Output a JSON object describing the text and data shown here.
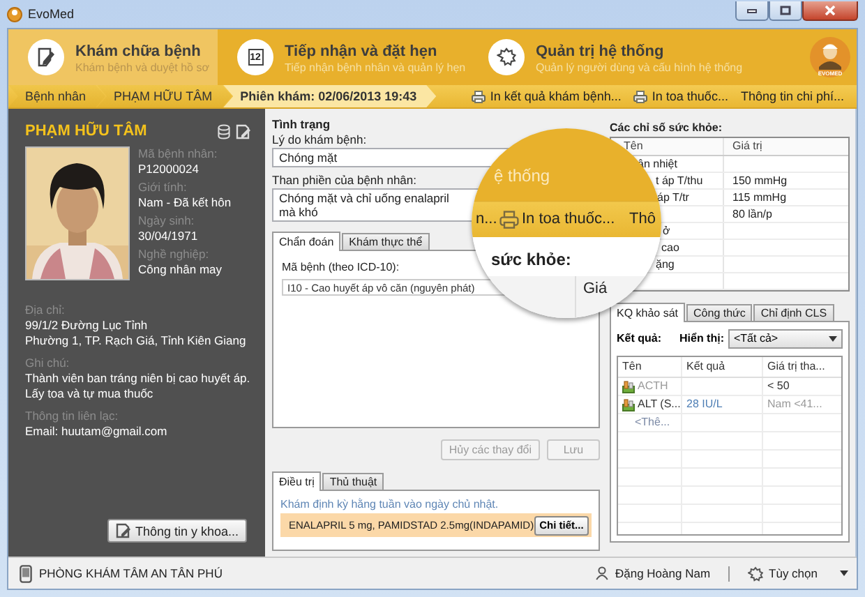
{
  "window": {
    "title": "EvoMed"
  },
  "nav": [
    {
      "title": "Khám chữa bệnh",
      "subtitle": "Khám bệnh và duyệt hồ sơ",
      "selected": true
    },
    {
      "title": "Tiếp nhận và đặt hẹn",
      "subtitle": "Tiếp nhận bệnh nhân và quản lý hẹn",
      "icon_text": "12",
      "selected": false
    },
    {
      "title": "Quản trị hệ thống",
      "subtitle": "Quản lý người dùng và cấu hình hệ thống",
      "selected": false
    }
  ],
  "logo_text": "EVOMED",
  "breadcrumb": [
    {
      "label": "Bệnh nhân",
      "selected": false
    },
    {
      "label": "PHẠM HỮU TÂM",
      "selected": false
    },
    {
      "label": "Phiên khám: 02/06/2013 19:43",
      "selected": true
    }
  ],
  "actions": [
    {
      "label": "In kết quả khám bệnh...",
      "kind": "print"
    },
    {
      "label": "In toa thuốc...",
      "kind": "print"
    },
    {
      "label": "Thông tin chi phí...",
      "kind": "link"
    }
  ],
  "patient": {
    "name": "PHẠM HỮU TÂM",
    "fields": [
      {
        "label": "Mã bệnh nhân:",
        "value": "P12000024"
      },
      {
        "label": "Giới tính:",
        "value": "Nam - Đã kết hôn"
      },
      {
        "label": "Ngày sinh:",
        "value": "30/04/1971"
      },
      {
        "label": "Nghề nghiệp:",
        "value": "Công nhân may"
      }
    ],
    "details": [
      {
        "label": "Địa chỉ:",
        "lines": [
          "99/1/2 Đường Lục Tỉnh",
          "Phường 1, TP. Rạch Giá, Tỉnh Kiên Giang"
        ]
      },
      {
        "label": "Ghi chú:",
        "lines": [
          "Thành viên ban tráng niên bị cao huyết áp. Lấy toa và tự mua thuốc"
        ]
      },
      {
        "label": "Thông tin liên lạc:",
        "lines": [
          "Email: huutam@gmail.com"
        ]
      }
    ],
    "medical_button": "Thông tin y khoa..."
  },
  "condition": {
    "title": "Tình trạng",
    "reason_label": "Lý do khám bệnh:",
    "reason": "Chóng mặt",
    "complaint_label": "Than phiền của bệnh nhân:",
    "complaint": "Chóng mặt và chỉ uống enalapril mà khó"
  },
  "diagnosis_tabs": [
    {
      "label": "Chẩn đoán",
      "selected": true
    },
    {
      "label": "Khám thực thể",
      "selected": false
    }
  ],
  "diagnosis": {
    "code_label": "Mã bệnh (theo ICD-10):",
    "codes": [
      "I10 - Cao huyết áp vô căn (nguyên phát)"
    ]
  },
  "form_buttons": [
    {
      "label": "Hủy các thay đổi",
      "disabled": true
    },
    {
      "label": "Lưu",
      "disabled": true
    }
  ],
  "treatment_tabs": [
    {
      "label": "Điều trị",
      "selected": true
    },
    {
      "label": "Thủ thuật",
      "selected": false
    }
  ],
  "treatment": {
    "note": "Khám định kỳ hằng tuần vào ngày chủ nhật.",
    "prescription": "ENALAPRIL 5 mg, PAMIDSTAD 2.5mg(INDAPAMID)",
    "detail_button": "Chi tiết..."
  },
  "vitals": {
    "title": "Các chỉ số sức khỏe:",
    "columns": [
      "Tên",
      "Giá trị"
    ],
    "rows": [
      {
        "name": "ân nhiệt"
      },
      {
        "name": "t áp T/thu",
        "value": "150 mmHg"
      },
      {
        "name": "áp T/tr",
        "value": "115 mmHg"
      },
      {
        "value": "80 lần/p"
      },
      {
        "name": "ở"
      },
      {
        "name": "cao"
      },
      {
        "name": "ặng"
      }
    ]
  },
  "results_tabs": [
    {
      "label": "KQ khảo sát",
      "selected": true
    },
    {
      "label": "Công thức",
      "selected": false
    },
    {
      "label": "Chỉ định CLS",
      "selected": false
    }
  ],
  "results": {
    "filter_label": "Kết quả:",
    "show_label": "Hiển thị:",
    "show_value": "<Tất cả>",
    "columns": [
      "Tên",
      "Kết quả",
      "Giá trị tha..."
    ],
    "rows": [
      {
        "kind": "test",
        "name": "ACTH",
        "reference": "< 50",
        "pending": true
      },
      {
        "kind": "test",
        "name": "ALT (S...",
        "result": "28 IU/L",
        "reference": "Nam <41...",
        "pending": false
      },
      {
        "kind": "add",
        "name": "<Thê..."
      }
    ]
  },
  "magnifier": {
    "header_text": "ệ thống",
    "bar_text": "n...",
    "action": "In toa thuốc...",
    "bar_tail": "Thô",
    "heading": "sức khỏe:",
    "cell": "Giá"
  },
  "status_bar": {
    "clinic": "PHÒNG KHÁM TÂM AN TÂN PHÚ",
    "user": "Đặng Hoàng Nam",
    "options": "Tùy chọn"
  }
}
